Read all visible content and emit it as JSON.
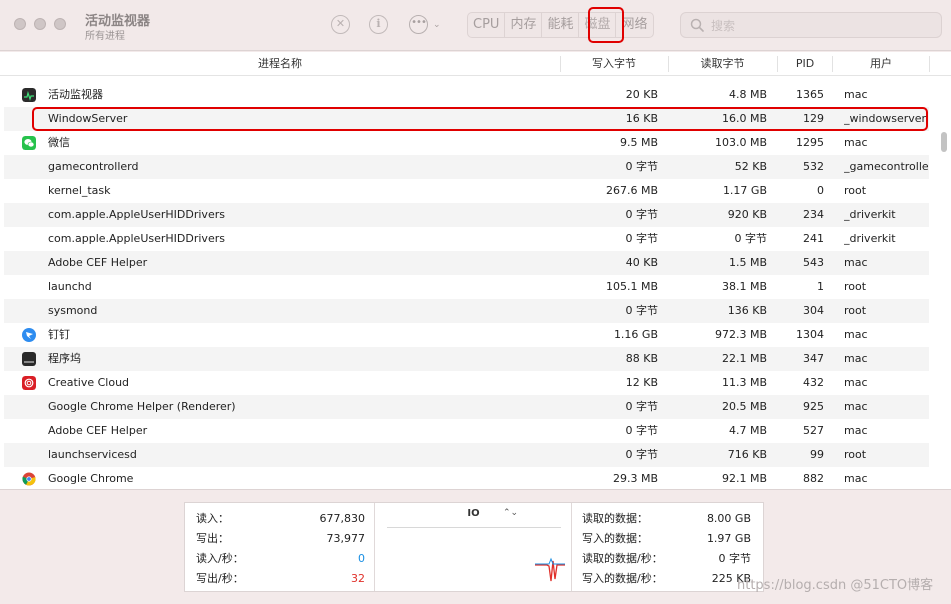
{
  "window": {
    "title": "活动监视器",
    "subtitle": "所有进程"
  },
  "toolbar": {
    "stop_icon": "stop-process-icon",
    "info_icon": "info-icon",
    "more_icon": "more-options-icon",
    "tabs": [
      {
        "label": "CPU",
        "active": false
      },
      {
        "label": "内存",
        "active": false
      },
      {
        "label": "能耗",
        "active": false
      },
      {
        "label": "磁盘",
        "active": true
      },
      {
        "label": "网络",
        "active": false
      }
    ],
    "search": {
      "placeholder": "搜索",
      "value": ""
    }
  },
  "table": {
    "headers": [
      "进程名称",
      "写入字节",
      "读取字节",
      "PID",
      "用户"
    ],
    "rows": [
      {
        "name": "活动监视器",
        "write": "20 KB",
        "read": "4.8 MB",
        "pid": "1365",
        "user": "mac",
        "icon": "activity-monitor-icon"
      },
      {
        "name": "WindowServer",
        "write": "16 KB",
        "read": "16.0 MB",
        "pid": "129",
        "user": "_windowserver",
        "icon": ""
      },
      {
        "name": "微信",
        "write": "9.5 MB",
        "read": "103.0 MB",
        "pid": "1295",
        "user": "mac",
        "icon": "wechat-icon"
      },
      {
        "name": "gamecontrollerd",
        "write": "0 字节",
        "read": "52 KB",
        "pid": "532",
        "user": "_gamecontrollerd",
        "icon": ""
      },
      {
        "name": "kernel_task",
        "write": "267.6 MB",
        "read": "1.17 GB",
        "pid": "0",
        "user": "root",
        "icon": ""
      },
      {
        "name": "com.apple.AppleUserHIDDrivers",
        "write": "0 字节",
        "read": "920 KB",
        "pid": "234",
        "user": "_driverkit",
        "icon": ""
      },
      {
        "name": "com.apple.AppleUserHIDDrivers",
        "write": "0 字节",
        "read": "0 字节",
        "pid": "241",
        "user": "_driverkit",
        "icon": ""
      },
      {
        "name": "Adobe CEF Helper",
        "write": "40 KB",
        "read": "1.5 MB",
        "pid": "543",
        "user": "mac",
        "icon": ""
      },
      {
        "name": "launchd",
        "write": "105.1 MB",
        "read": "38.1 MB",
        "pid": "1",
        "user": "root",
        "icon": ""
      },
      {
        "name": "sysmond",
        "write": "0 字节",
        "read": "136 KB",
        "pid": "304",
        "user": "root",
        "icon": ""
      },
      {
        "name": "钉钉",
        "write": "1.16 GB",
        "read": "972.3 MB",
        "pid": "1304",
        "user": "mac",
        "icon": "dingtalk-icon"
      },
      {
        "name": "程序坞",
        "write": "88 KB",
        "read": "22.1 MB",
        "pid": "347",
        "user": "mac",
        "icon": "dock-icon"
      },
      {
        "name": "Creative Cloud",
        "write": "12 KB",
        "read": "11.3 MB",
        "pid": "432",
        "user": "mac",
        "icon": "creative-cloud-icon"
      },
      {
        "name": "Google Chrome Helper (Renderer)",
        "write": "0 字节",
        "read": "20.5 MB",
        "pid": "925",
        "user": "mac",
        "icon": ""
      },
      {
        "name": "Adobe CEF Helper",
        "write": "0 字节",
        "read": "4.7 MB",
        "pid": "527",
        "user": "mac",
        "icon": ""
      },
      {
        "name": "launchservicesd",
        "write": "0 字节",
        "read": "716 KB",
        "pid": "99",
        "user": "root",
        "icon": ""
      },
      {
        "name": "Google Chrome",
        "write": "29.3 MB",
        "read": "92.1 MB",
        "pid": "882",
        "user": "mac",
        "icon": "chrome-icon"
      }
    ]
  },
  "stats": {
    "left": [
      {
        "label": "读入：",
        "value": "677,830",
        "color": "#222222"
      },
      {
        "label": "写出：",
        "value": "73,977",
        "color": "#222222"
      },
      {
        "label": "读入/秒：",
        "value": "0",
        "color": "#1a8fe3"
      },
      {
        "label": "写出/秒：",
        "value": "32",
        "color": "#e0302a"
      }
    ],
    "graph_selector": "IO",
    "right": [
      {
        "label": "读取的数据：",
        "value": "8.00 GB"
      },
      {
        "label": "写入的数据：",
        "value": "1.97 GB"
      },
      {
        "label": "读取的数据/秒：",
        "value": "0 字节"
      },
      {
        "label": "写入的数据/秒：",
        "value": "225 KB"
      }
    ]
  },
  "watermark": "https://blog.csdn @51CTO博客",
  "colors": {
    "highlight": "#e00000",
    "read_rate": "#1a8fe3",
    "write_rate": "#e0302a"
  }
}
